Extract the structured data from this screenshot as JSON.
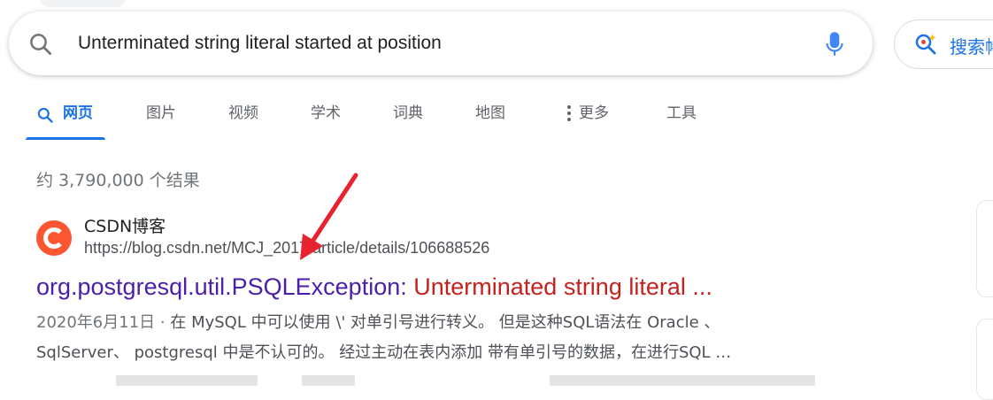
{
  "search": {
    "query": "Unterminated string literal started at position",
    "lens_label": "搜索帾"
  },
  "tabs": [
    {
      "label": "网页",
      "active": true
    },
    {
      "label": "图片",
      "active": false
    },
    {
      "label": "视频",
      "active": false
    },
    {
      "label": "学术",
      "active": false
    },
    {
      "label": "词典",
      "active": false
    },
    {
      "label": "地图",
      "active": false
    },
    {
      "label": "更多",
      "active": false
    },
    {
      "label": "工具",
      "active": false
    }
  ],
  "results_count": "约 3,790,000 个结果",
  "result": {
    "site_name": "CSDN博客",
    "favicon_letter": "C",
    "url": "https://blog.csdn.net/MCJ_2017/article/details/106688526",
    "title_part1": "org.postgresql.util.PSQLException: ",
    "title_part2": "Unterminated string literal ...",
    "date": "2020年6月11日",
    "separator": " · ",
    "snippet_line1": "在 MySQL 中可以使用 \\' 对单引号进行转义。 但是这种SQL语法在 Oracle 、",
    "snippet_line2": "SqlServer、 postgresql 中是不认可的。 经过主动在表内添加 带有单引号的数据，在进行SQL …"
  },
  "colors": {
    "accent": "#1a73e8",
    "visited_link": "#4b1fa7",
    "highlight": "#c5221f",
    "favicon_bg": "#fc5531",
    "annotation_arrow": "#e8232f"
  },
  "icons": [
    "search-icon",
    "microphone-icon",
    "lens-icon",
    "more-dots-icon",
    "annotation-arrow"
  ]
}
